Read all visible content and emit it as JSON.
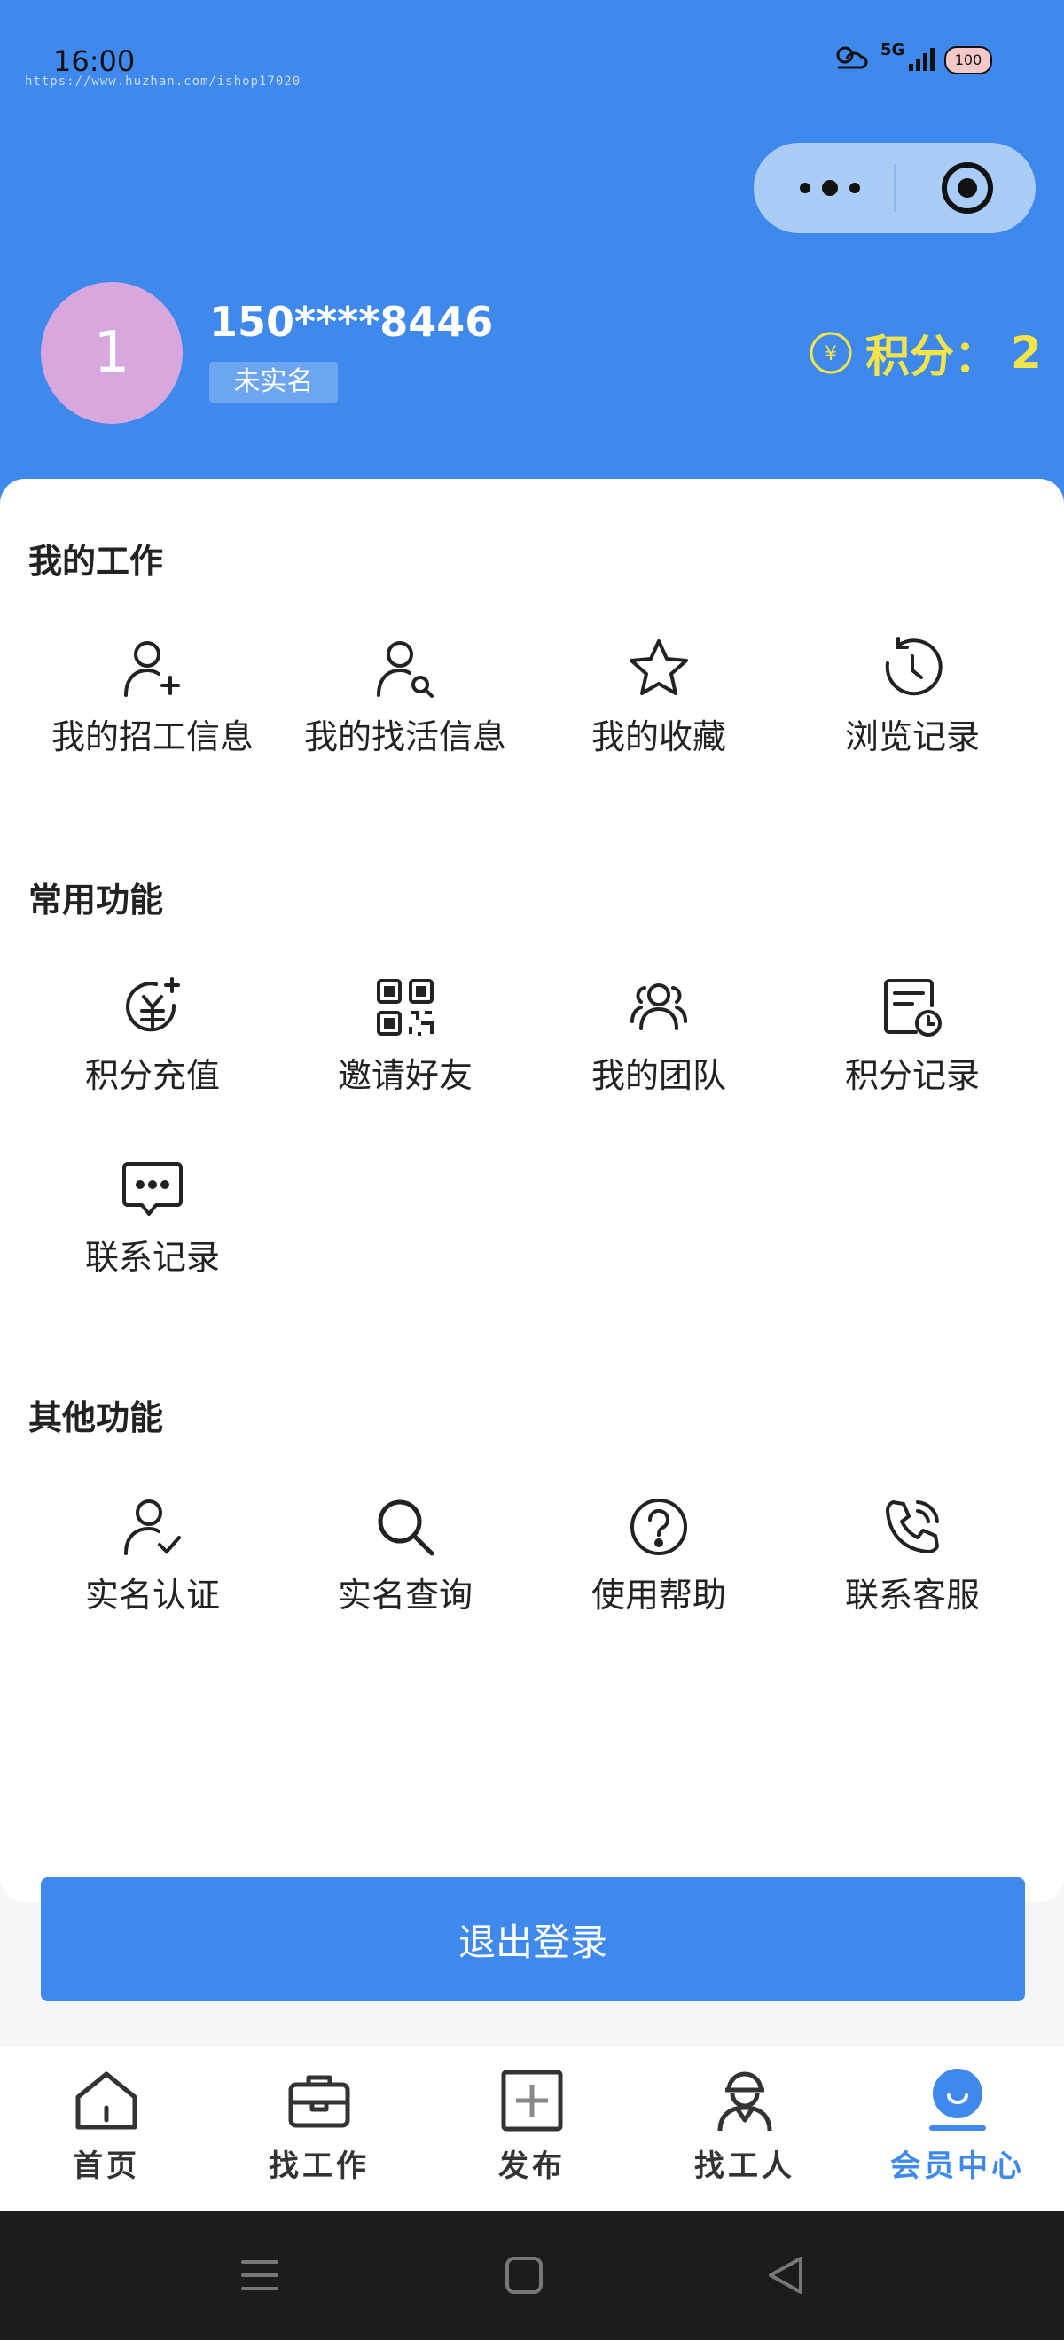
{
  "status_bar": {
    "time": "16:00",
    "url": "https://www.huzhan.com/ishop17020",
    "network": "5G",
    "battery": "100"
  },
  "profile": {
    "avatar_text": "1",
    "phone": "150****8446",
    "badge": "未实名",
    "points_label": "积分：",
    "points_value": "2"
  },
  "sections": {
    "work": {
      "title": "我的工作",
      "items": [
        "我的招工信息",
        "我的找活信息",
        "我的收藏",
        "浏览记录"
      ]
    },
    "common": {
      "title": "常用功能",
      "items": [
        "积分充值",
        "邀请好友",
        "我的团队",
        "积分记录",
        "联系记录"
      ]
    },
    "other": {
      "title": "其他功能",
      "items": [
        "实名认证",
        "实名查询",
        "使用帮助",
        "联系客服"
      ]
    }
  },
  "logout_label": "退出登录",
  "tabs": [
    "首页",
    "找工作",
    "发布",
    "找工人",
    "会员中心"
  ],
  "colors": {
    "primary": "#3f88ec",
    "points": "#f6e54a",
    "avatar": "#d8a7dd"
  }
}
